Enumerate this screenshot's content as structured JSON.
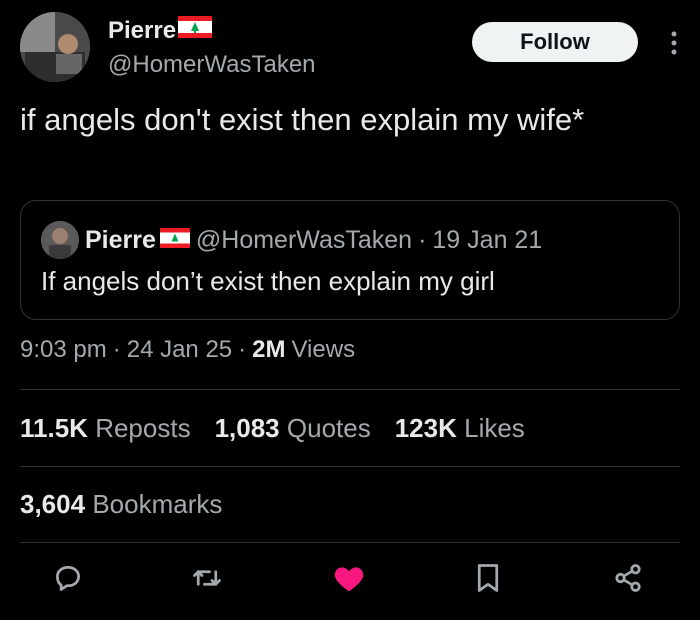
{
  "author": {
    "display_name": "Pierre",
    "handle": "@HomerWasTaken",
    "flag_icon": "lebanon-flag-icon"
  },
  "follow_label": "Follow",
  "tweet": {
    "text": "if angels don't exist then explain my wife*"
  },
  "quote": {
    "display_name": "Pierre",
    "handle": "@HomerWasTaken",
    "separator": "·",
    "date": "19 Jan 21",
    "text": "If angels don’t exist then explain my girl"
  },
  "meta": {
    "time": "9:03 pm",
    "sep1": "·",
    "date": "24 Jan 25",
    "sep2": "·",
    "views_count": "2M",
    "views_label": "Views"
  },
  "stats": {
    "reposts_count": "11.5K",
    "reposts_label": "Reposts",
    "quotes_count": "1,083",
    "quotes_label": "Quotes",
    "likes_count": "123K",
    "likes_label": "Likes",
    "bookmarks_count": "3,604",
    "bookmarks_label": "Bookmarks"
  },
  "colors": {
    "background": "#000000",
    "text": "#e7e9ea",
    "secondary": "#a4a9ad",
    "like_active": "#f91880",
    "divider": "#2f3336"
  },
  "actions": [
    "reply-icon",
    "repost-icon",
    "like-icon",
    "bookmark-icon",
    "share-icon"
  ]
}
